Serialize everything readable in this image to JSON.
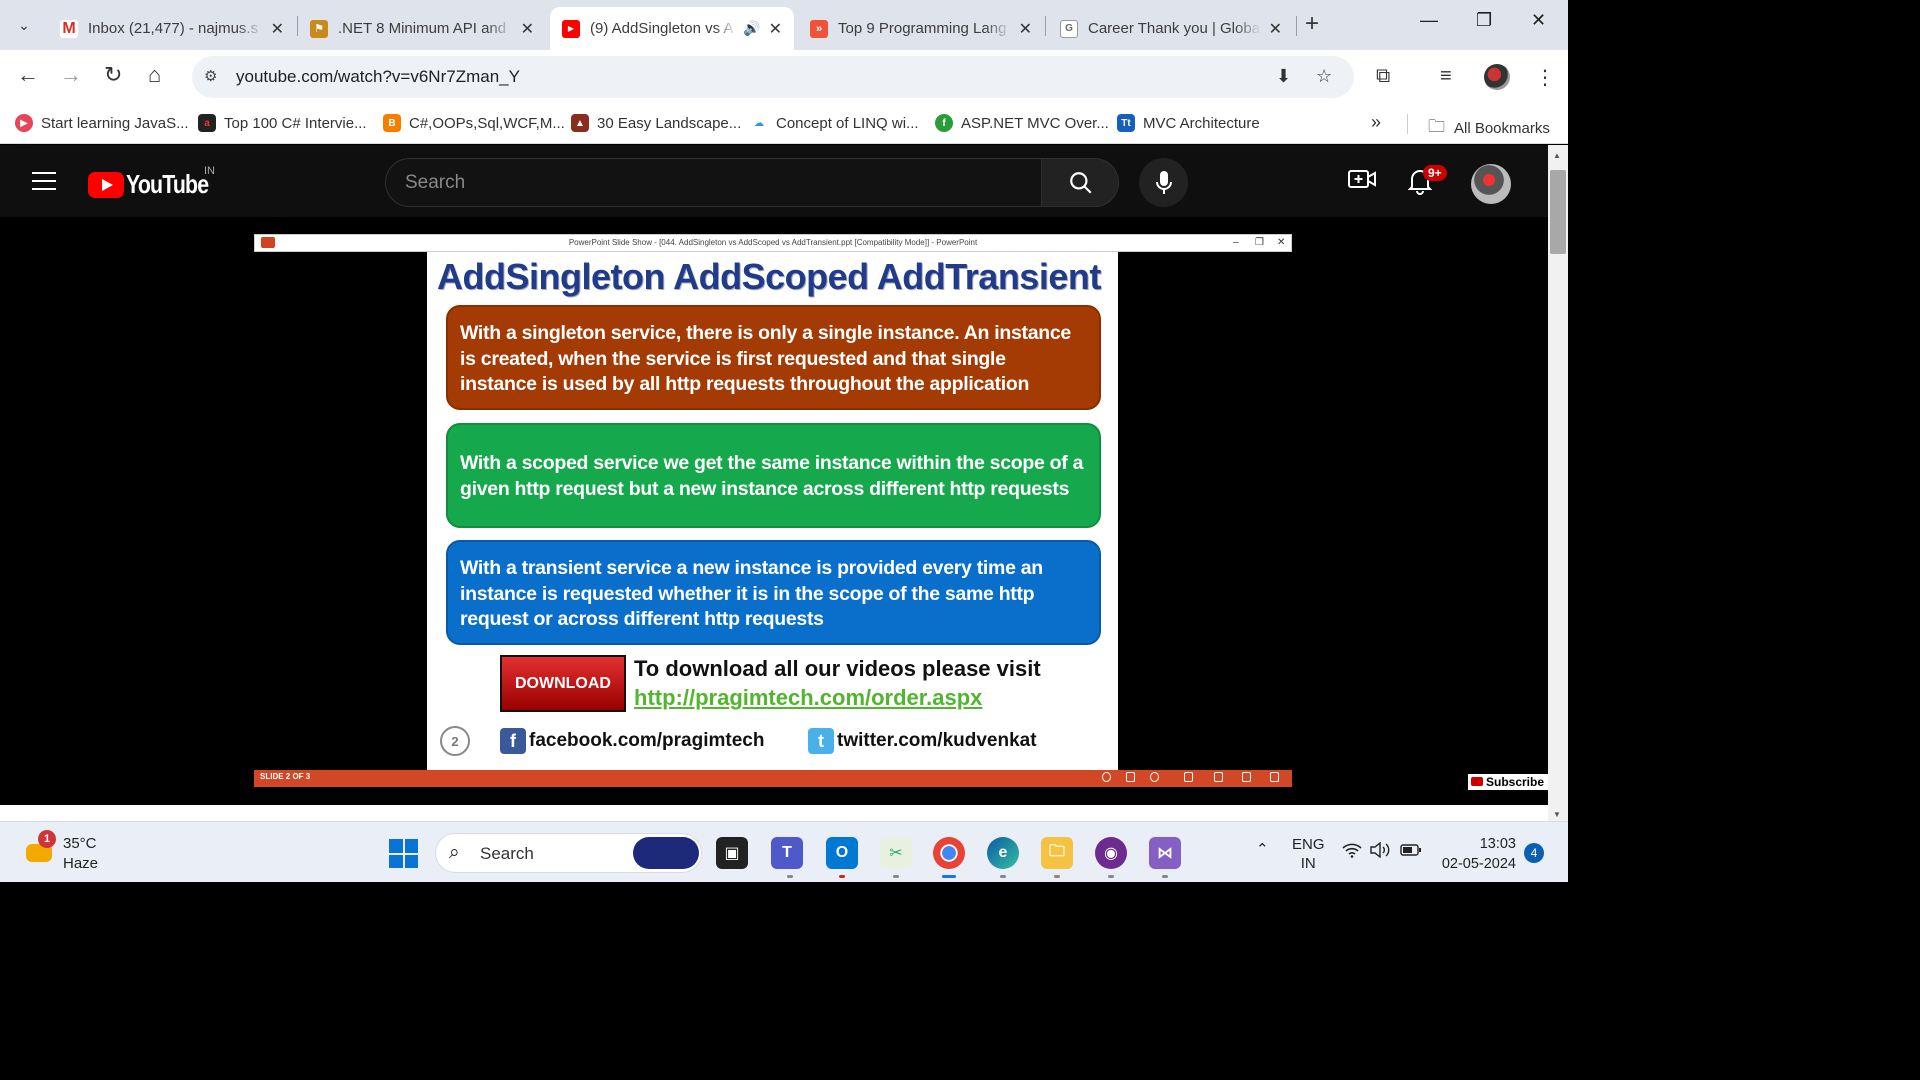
{
  "browser": {
    "tabs": [
      {
        "title": "Inbox (21,477) - najmus.s",
        "favicon": "gmail-icon"
      },
      {
        "title": ".NET 8 Minimum API and",
        "favicon": "bookmark-icon"
      },
      {
        "title": "(9) AddSingleton vs A",
        "favicon": "youtube-icon",
        "active": true
      },
      {
        "title": "Top 9 Programming Lang",
        "favicon": "swift-icon"
      },
      {
        "title": "Career Thank you | Globa",
        "favicon": "google-icon"
      }
    ],
    "url": "youtube.com/watch?v=v6Nr7Zman_Y",
    "bookmarks": [
      "Start learning JavaS...",
      "Top 100 C# Intervie...",
      "C#,OOPs,Sql,WCF,M...",
      "30 Easy Landscape...",
      "Concept of LINQ wi...",
      "ASP.NET MVC Over...",
      "MVC Architecture"
    ],
    "all_bookmarks": "All Bookmarks",
    "overflow": "»"
  },
  "youtube": {
    "logo": "YouTube",
    "country": "IN",
    "search_placeholder": "Search",
    "notifications": "9+",
    "subscribe": "Subscribe"
  },
  "powerpoint": {
    "window_title": "PowerPoint Slide Show - [044. AddSingleton vs AddScoped vs AddTransient.ppt [Compatibility Mode]] - PowerPoint",
    "status": "SLIDE 2 OF 3"
  },
  "slide": {
    "title": "AddSingleton AddScoped AddTransient",
    "boxes": [
      "With a singleton service, there is only a single instance. An instance is created, when the service is first requested and that single instance is used by all http requests throughout the application",
      "With a scoped service we get the same instance within the scope of a given http request but a new instance across different http requests",
      "With a transient service a new instance is provided every time an instance is requested whether it is in the scope of the same http request or across different http requests"
    ],
    "download_button": "DOWNLOAD",
    "download_text": "To download all our videos please visit",
    "download_link": "http://pragimtech.com/order.aspx",
    "page_number": "2",
    "facebook": "facebook.com/pragimtech",
    "twitter": "twitter.com/kudvenkat"
  },
  "taskbar": {
    "temperature": "35°C",
    "weather": "Haze",
    "weather_badge": "1",
    "search": "Search",
    "language": "ENG",
    "region": "IN",
    "time": "13:03",
    "date": "02-05-2024",
    "notifications": "4"
  }
}
